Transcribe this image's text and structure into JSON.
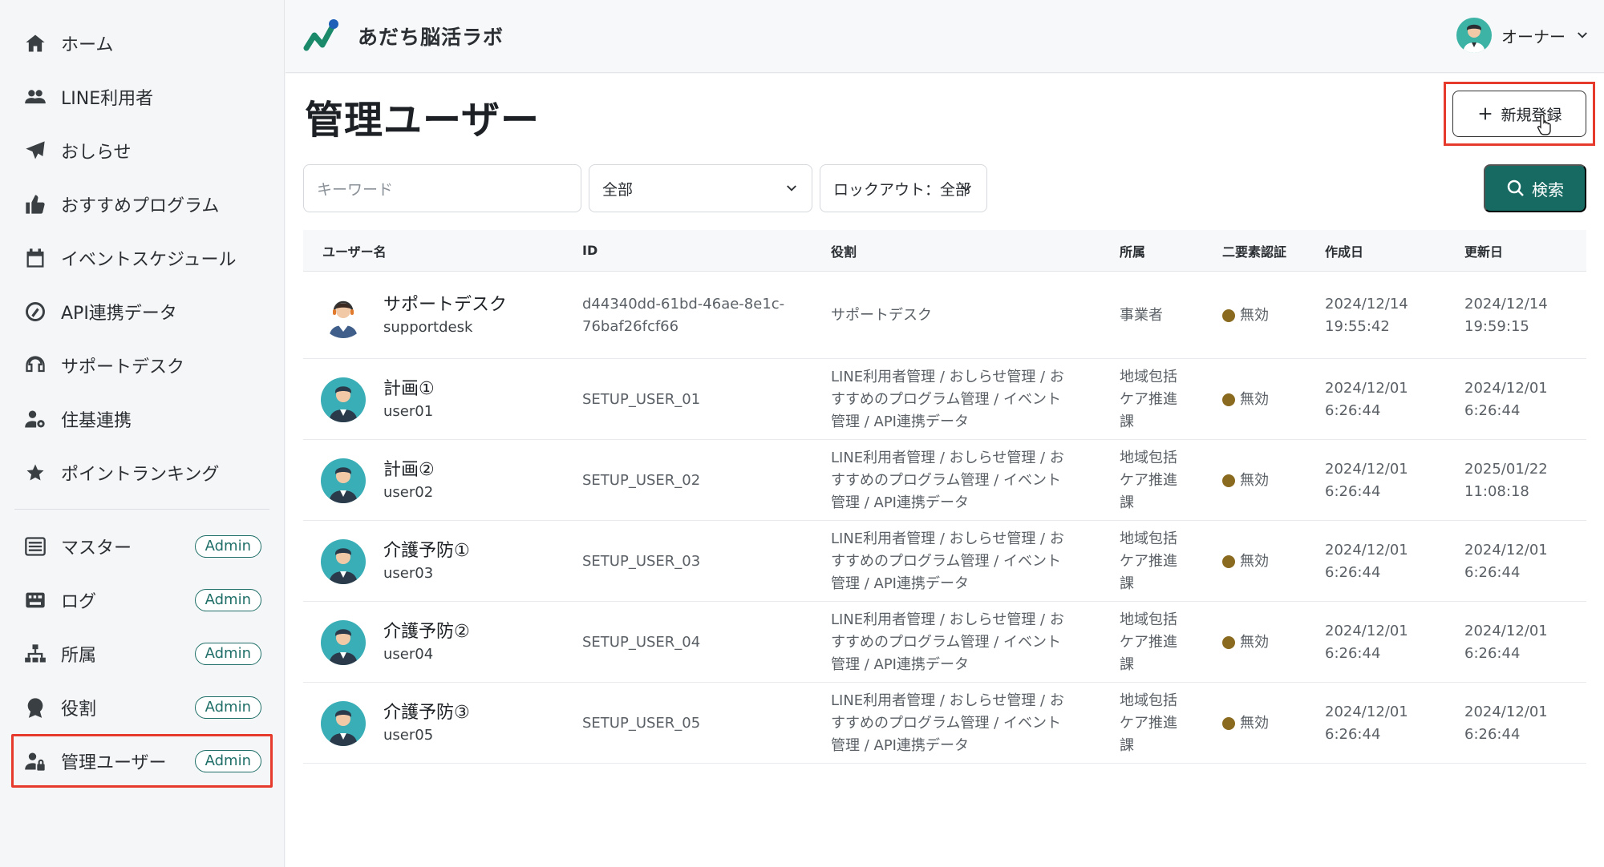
{
  "sidebar": {
    "items": [
      {
        "label": "ホーム",
        "icon": "home-icon"
      },
      {
        "label": "LINE利用者",
        "icon": "users-icon"
      },
      {
        "label": "おしらせ",
        "icon": "paper-plane-icon"
      },
      {
        "label": "おすすめプログラム",
        "icon": "thumbs-up-icon"
      },
      {
        "label": "イベントスケジュール",
        "icon": "calendar-icon"
      },
      {
        "label": "API連携データ",
        "icon": "api-icon"
      },
      {
        "label": "サポートデスク",
        "icon": "headset-icon"
      },
      {
        "label": "住基連携",
        "icon": "user-gear-icon"
      },
      {
        "label": "ポイントランキング",
        "icon": "star-icon"
      }
    ],
    "admin_items": [
      {
        "label": "マスター",
        "icon": "list-icon",
        "badge": "Admin"
      },
      {
        "label": "ログ",
        "icon": "keyboard-icon",
        "badge": "Admin"
      },
      {
        "label": "所属",
        "icon": "sitemap-icon",
        "badge": "Admin"
      },
      {
        "label": "役割",
        "icon": "award-icon",
        "badge": "Admin"
      },
      {
        "label": "管理ユーザー",
        "icon": "user-lock-icon",
        "badge": "Admin"
      }
    ]
  },
  "header": {
    "brand": "あだち脳活ラボ",
    "user_name": "オーナー"
  },
  "main": {
    "title": "管理ユーザー",
    "new_button": "新規登録",
    "search": {
      "keyword_placeholder": "キーワード",
      "affiliation_selected": "全部",
      "lockout_selected": "ロックアウト：全部",
      "button": "検索"
    },
    "table": {
      "headers": [
        "ユーザー名",
        "ID",
        "役割",
        "所属",
        "二要素認証",
        "作成日",
        "更新日"
      ],
      "rows": [
        {
          "name": "サポートデスク",
          "login": "supportdesk",
          "id1": "d44340dd-61bd-46ae-8e1c-",
          "id2": "76baf26fcf66",
          "role1": "サポートデスク",
          "role2": "",
          "role3": "",
          "aff1": "事業者",
          "aff2": "",
          "aff3": "",
          "mfa": "無効",
          "created_date": "2024/12/14",
          "created_time": "19:55:42",
          "updated_date": "2024/12/14",
          "updated_time": "19:59:15"
        },
        {
          "name": "計画①",
          "login": "user01",
          "id1": "SETUP_USER_01",
          "id2": "",
          "role1": "LINE利用者管理 / おしらせ管理 / お",
          "role2": "すすめのプログラム管理 / イベント",
          "role3": "管理 / API連携データ",
          "aff1": "地域包括",
          "aff2": "ケア推進",
          "aff3": "課",
          "mfa": "無効",
          "created_date": "2024/12/01",
          "created_time": "6:26:44",
          "updated_date": "2024/12/01",
          "updated_time": "6:26:44"
        },
        {
          "name": "計画②",
          "login": "user02",
          "id1": "SETUP_USER_02",
          "id2": "",
          "role1": "LINE利用者管理 / おしらせ管理 / お",
          "role2": "すすめのプログラム管理 / イベント",
          "role3": "管理 / API連携データ",
          "aff1": "地域包括",
          "aff2": "ケア推進",
          "aff3": "課",
          "mfa": "無効",
          "created_date": "2024/12/01",
          "created_time": "6:26:44",
          "updated_date": "2025/01/22",
          "updated_time": "11:08:18"
        },
        {
          "name": "介護予防①",
          "login": "user03",
          "id1": "SETUP_USER_03",
          "id2": "",
          "role1": "LINE利用者管理 / おしらせ管理 / お",
          "role2": "すすめのプログラム管理 / イベント",
          "role3": "管理 / API連携データ",
          "aff1": "地域包括",
          "aff2": "ケア推進",
          "aff3": "課",
          "mfa": "無効",
          "created_date": "2024/12/01",
          "created_time": "6:26:44",
          "updated_date": "2024/12/01",
          "updated_time": "6:26:44"
        },
        {
          "name": "介護予防②",
          "login": "user04",
          "id1": "SETUP_USER_04",
          "id2": "",
          "role1": "LINE利用者管理 / おしらせ管理 / お",
          "role2": "すすめのプログラム管理 / イベント",
          "role3": "管理 / API連携データ",
          "aff1": "地域包括",
          "aff2": "ケア推進",
          "aff3": "課",
          "mfa": "無効",
          "created_date": "2024/12/01",
          "created_time": "6:26:44",
          "updated_date": "2024/12/01",
          "updated_time": "6:26:44"
        },
        {
          "name": "介護予防③",
          "login": "user05",
          "id1": "SETUP_USER_05",
          "id2": "",
          "role1": "LINE利用者管理 / おしらせ管理 / お",
          "role2": "すすめのプログラム管理 / イベント",
          "role3": "管理 / API連携データ",
          "aff1": "地域包括",
          "aff2": "ケア推進",
          "aff3": "課",
          "mfa": "無効",
          "created_date": "2024/12/01",
          "created_time": "6:26:44",
          "updated_date": "2024/12/01",
          "updated_time": "6:26:44"
        }
      ]
    }
  },
  "colors": {
    "accent": "#166a62",
    "highlight": "#e53a2c",
    "status_dot": "#8a6a1e"
  }
}
